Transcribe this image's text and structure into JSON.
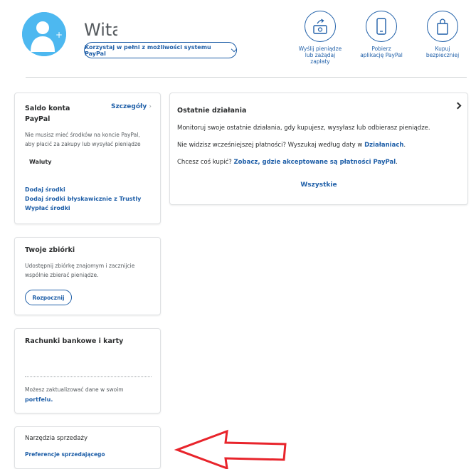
{
  "header": {
    "greeting": "Witaj",
    "primary_button": "Korzystaj w pełni z możliwości systemu PayPal",
    "quick_actions": [
      {
        "label_lines": [
          "Wyślij pieniądze",
          "lub zażądaj",
          "zapłaty"
        ],
        "icon": "send-money-icon"
      },
      {
        "label_lines": [
          "Pobierz",
          "aplikację PayPal"
        ],
        "icon": "phone-icon"
      },
      {
        "label_lines": [
          "Kupuj",
          "bezpieczniej"
        ],
        "icon": "shopping-bag-icon"
      }
    ]
  },
  "balance": {
    "title_line1": "Saldo konta",
    "title_line2": "PayPal",
    "details_link": "Szczegóły",
    "info_line1": "Nie musisz mieć środków na koncie PayPal,",
    "info_line2": "aby płacić za zakupy lub wysyłać pieniądze",
    "currencies_label": "Waluty",
    "links": [
      "Dodaj środki",
      "Dodaj środki błyskawicznie z Trustly",
      "Wypłać środki"
    ]
  },
  "pools": {
    "title": "Twoje zbiórki",
    "text_line1": "Udostępnij zbiórkę znajomym i zacznijcie",
    "text_line2": "wspólnie zbierać pieniądze.",
    "button": "Rozpocznij"
  },
  "banks": {
    "title": "Rachunki bankowe i karty",
    "text": "Możesz zaktualizować dane w swoim",
    "link": "portfelu."
  },
  "seller_tools": {
    "title": "Narzędzia sprzedaży",
    "link": "Preferencje sprzedającego"
  },
  "activity": {
    "title": "Ostatnie działania",
    "line1": "Monitoruj swoje ostatnie działania, gdy kupujesz, wysyłasz lub odbierasz pieniądze.",
    "line2_text": "Nie widzisz wcześniejszej płatności? Wyszukaj według daty w ",
    "line2_link": "Działaniach",
    "line2_end": ".",
    "line3_text": "Chcesz coś kupić? ",
    "line3_link": "Zobacz, gdzie akceptowane są płatności PayPal",
    "line3_end": ".",
    "all_link": "Wszystkie"
  },
  "colors": {
    "brand_blue": "#1f5fa8",
    "avatar_blue": "#4db8f0",
    "annotation_red": "#e8242b"
  }
}
